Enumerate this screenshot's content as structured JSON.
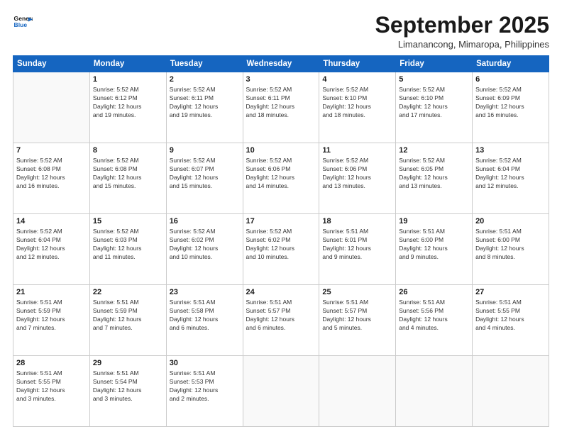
{
  "header": {
    "logo_line1": "General",
    "logo_line2": "Blue",
    "month": "September 2025",
    "location": "Limanancong, Mimaropa, Philippines"
  },
  "days_of_week": [
    "Sunday",
    "Monday",
    "Tuesday",
    "Wednesday",
    "Thursday",
    "Friday",
    "Saturday"
  ],
  "weeks": [
    [
      {
        "day": "",
        "info": ""
      },
      {
        "day": "1",
        "info": "Sunrise: 5:52 AM\nSunset: 6:12 PM\nDaylight: 12 hours\nand 19 minutes."
      },
      {
        "day": "2",
        "info": "Sunrise: 5:52 AM\nSunset: 6:11 PM\nDaylight: 12 hours\nand 19 minutes."
      },
      {
        "day": "3",
        "info": "Sunrise: 5:52 AM\nSunset: 6:11 PM\nDaylight: 12 hours\nand 18 minutes."
      },
      {
        "day": "4",
        "info": "Sunrise: 5:52 AM\nSunset: 6:10 PM\nDaylight: 12 hours\nand 18 minutes."
      },
      {
        "day": "5",
        "info": "Sunrise: 5:52 AM\nSunset: 6:10 PM\nDaylight: 12 hours\nand 17 minutes."
      },
      {
        "day": "6",
        "info": "Sunrise: 5:52 AM\nSunset: 6:09 PM\nDaylight: 12 hours\nand 16 minutes."
      }
    ],
    [
      {
        "day": "7",
        "info": "Sunrise: 5:52 AM\nSunset: 6:08 PM\nDaylight: 12 hours\nand 16 minutes."
      },
      {
        "day": "8",
        "info": "Sunrise: 5:52 AM\nSunset: 6:08 PM\nDaylight: 12 hours\nand 15 minutes."
      },
      {
        "day": "9",
        "info": "Sunrise: 5:52 AM\nSunset: 6:07 PM\nDaylight: 12 hours\nand 15 minutes."
      },
      {
        "day": "10",
        "info": "Sunrise: 5:52 AM\nSunset: 6:06 PM\nDaylight: 12 hours\nand 14 minutes."
      },
      {
        "day": "11",
        "info": "Sunrise: 5:52 AM\nSunset: 6:06 PM\nDaylight: 12 hours\nand 13 minutes."
      },
      {
        "day": "12",
        "info": "Sunrise: 5:52 AM\nSunset: 6:05 PM\nDaylight: 12 hours\nand 13 minutes."
      },
      {
        "day": "13",
        "info": "Sunrise: 5:52 AM\nSunset: 6:04 PM\nDaylight: 12 hours\nand 12 minutes."
      }
    ],
    [
      {
        "day": "14",
        "info": "Sunrise: 5:52 AM\nSunset: 6:04 PM\nDaylight: 12 hours\nand 12 minutes."
      },
      {
        "day": "15",
        "info": "Sunrise: 5:52 AM\nSunset: 6:03 PM\nDaylight: 12 hours\nand 11 minutes."
      },
      {
        "day": "16",
        "info": "Sunrise: 5:52 AM\nSunset: 6:02 PM\nDaylight: 12 hours\nand 10 minutes."
      },
      {
        "day": "17",
        "info": "Sunrise: 5:52 AM\nSunset: 6:02 PM\nDaylight: 12 hours\nand 10 minutes."
      },
      {
        "day": "18",
        "info": "Sunrise: 5:51 AM\nSunset: 6:01 PM\nDaylight: 12 hours\nand 9 minutes."
      },
      {
        "day": "19",
        "info": "Sunrise: 5:51 AM\nSunset: 6:00 PM\nDaylight: 12 hours\nand 9 minutes."
      },
      {
        "day": "20",
        "info": "Sunrise: 5:51 AM\nSunset: 6:00 PM\nDaylight: 12 hours\nand 8 minutes."
      }
    ],
    [
      {
        "day": "21",
        "info": "Sunrise: 5:51 AM\nSunset: 5:59 PM\nDaylight: 12 hours\nand 7 minutes."
      },
      {
        "day": "22",
        "info": "Sunrise: 5:51 AM\nSunset: 5:59 PM\nDaylight: 12 hours\nand 7 minutes."
      },
      {
        "day": "23",
        "info": "Sunrise: 5:51 AM\nSunset: 5:58 PM\nDaylight: 12 hours\nand 6 minutes."
      },
      {
        "day": "24",
        "info": "Sunrise: 5:51 AM\nSunset: 5:57 PM\nDaylight: 12 hours\nand 6 minutes."
      },
      {
        "day": "25",
        "info": "Sunrise: 5:51 AM\nSunset: 5:57 PM\nDaylight: 12 hours\nand 5 minutes."
      },
      {
        "day": "26",
        "info": "Sunrise: 5:51 AM\nSunset: 5:56 PM\nDaylight: 12 hours\nand 4 minutes."
      },
      {
        "day": "27",
        "info": "Sunrise: 5:51 AM\nSunset: 5:55 PM\nDaylight: 12 hours\nand 4 minutes."
      }
    ],
    [
      {
        "day": "28",
        "info": "Sunrise: 5:51 AM\nSunset: 5:55 PM\nDaylight: 12 hours\nand 3 minutes."
      },
      {
        "day": "29",
        "info": "Sunrise: 5:51 AM\nSunset: 5:54 PM\nDaylight: 12 hours\nand 3 minutes."
      },
      {
        "day": "30",
        "info": "Sunrise: 5:51 AM\nSunset: 5:53 PM\nDaylight: 12 hours\nand 2 minutes."
      },
      {
        "day": "",
        "info": ""
      },
      {
        "day": "",
        "info": ""
      },
      {
        "day": "",
        "info": ""
      },
      {
        "day": "",
        "info": ""
      }
    ]
  ]
}
